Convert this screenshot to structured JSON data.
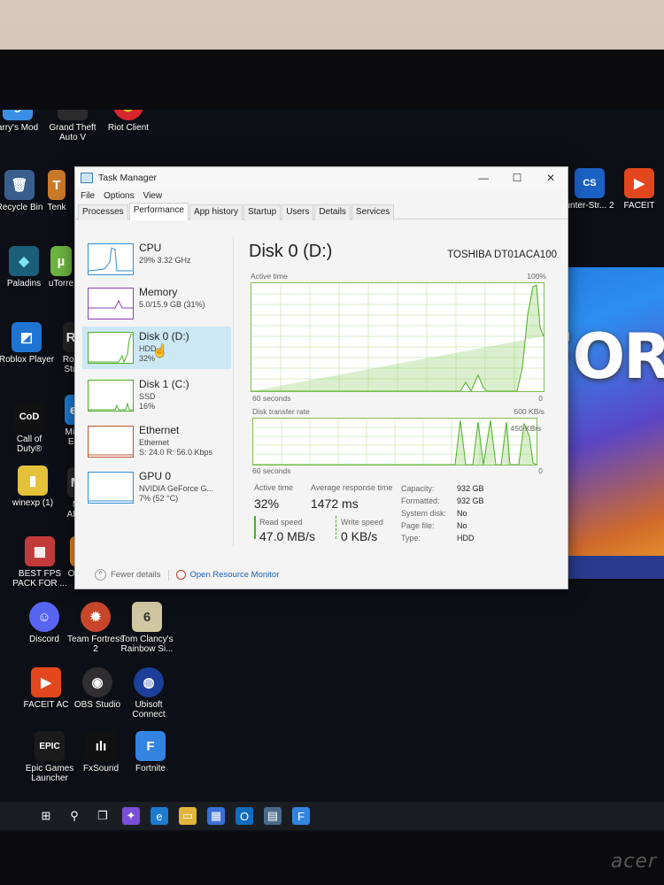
{
  "desktop": {
    "icons": [
      {
        "label": "arry's Mod",
        "glyph": "g",
        "color": "#3a8ee6"
      },
      {
        "label": "Grand Theft Auto V",
        "glyph": "V",
        "color": "#2b2b2b"
      },
      {
        "label": "Riot Client",
        "glyph": "✊",
        "color": "#d7262e"
      },
      {
        "label": "Recycle Bin",
        "glyph": "🗑",
        "color": "#3a5f8f"
      },
      {
        "label": "Tenk",
        "glyph": "T",
        "color": "#cc7a2a"
      },
      {
        "label": "Paladins",
        "glyph": "◆",
        "color": "#3fb0c8"
      },
      {
        "label": "uTorre",
        "glyph": "µ",
        "color": "#6db33f"
      },
      {
        "label": "Roblox Player",
        "glyph": "◩",
        "color": "#1f74d2"
      },
      {
        "label": "Rob Stu",
        "glyph": "R",
        "color": "#222"
      },
      {
        "label": "Call of Duty®",
        "glyph": "CoD",
        "color": "#111"
      },
      {
        "label": "Micr Ed",
        "glyph": "e",
        "color": "#1e7ad1"
      },
      {
        "label": "winexp (1)",
        "glyph": "▮",
        "color": "#e4c13b"
      },
      {
        "label": "M After",
        "glyph": "M",
        "color": "#2a2a2a"
      },
      {
        "label": "BEST FPS PACK FOR ...",
        "glyph": "▦",
        "color": "#c23b3b"
      },
      {
        "label": "Overv",
        "glyph": "◎",
        "color": "#f08a1c"
      },
      {
        "label": "Discord",
        "glyph": "☺",
        "color": "#5865f2"
      },
      {
        "label": "Team Fortress 2",
        "glyph": "✹",
        "color": "#c8472b"
      },
      {
        "label": "Tom Clancy's Rainbow Si...",
        "glyph": "6",
        "color": "#d0c7a2"
      },
      {
        "label": "FACEIT AC",
        "glyph": "▶",
        "color": "#e2471d"
      },
      {
        "label": "OBS Studio",
        "glyph": "◉",
        "color": "#302e31"
      },
      {
        "label": "Ubisoft Connect",
        "glyph": "◍",
        "color": "#1c3f9a"
      },
      {
        "label": "Epic Games Launcher",
        "glyph": "EPIC",
        "color": "#1b1b1b"
      },
      {
        "label": "FxSound",
        "glyph": "ılı",
        "color": "#111"
      },
      {
        "label": "Fortnite",
        "glyph": "F",
        "color": "#3384e0"
      },
      {
        "label": "unter-Str... 2",
        "glyph": "CS",
        "color": "#1b61c4"
      },
      {
        "label": "FACEIT",
        "glyph": "▶",
        "color": "#e2471d"
      }
    ],
    "wallpaper_text": "FOR"
  },
  "taskmanager": {
    "title": "Task Manager",
    "window_controls": [
      "—",
      "☐",
      "✕"
    ],
    "menu": [
      "File",
      "Options",
      "View"
    ],
    "tabs": [
      "Processes",
      "Performance",
      "App history",
      "Startup",
      "Users",
      "Details",
      "Services"
    ],
    "active_tab": "Performance",
    "sidebar": [
      {
        "name": "CPU",
        "line1": "29% 3.32 GHz",
        "line2": "",
        "color": "#2f8fd8"
      },
      {
        "name": "Memory",
        "line1": "5.0/15.9 GB (31%)",
        "line2": "",
        "color": "#8b3fb5"
      },
      {
        "name": "Disk 0 (D:)",
        "line1": "HDD",
        "line2": "32%",
        "color": "#4caf28"
      },
      {
        "name": "Disk 1 (C:)",
        "line1": "SSD",
        "line2": "16%",
        "color": "#4caf28"
      },
      {
        "name": "Ethernet",
        "line1": "Ethernet",
        "line2": "S: 24.0  R: 56.0 Kbps",
        "color": "#c0522b"
      },
      {
        "name": "GPU 0",
        "line1": "NVIDIA GeForce G...",
        "line2": "7% (52 °C)",
        "color": "#2f8fd8"
      }
    ],
    "detail": {
      "title": "Disk 0 (D:)",
      "model": "TOSHIBA DT01ACA100",
      "graph1_label": "Active time",
      "graph1_max": "100%",
      "graph1_xleft": "60 seconds",
      "graph1_xright": "0",
      "graph2_label": "Disk transfer rate",
      "graph2_max": "500 KB/s",
      "graph2_mid": "450 KB/s",
      "graph2_xleft": "60 seconds",
      "graph2_xright": "0",
      "active_time_label": "Active time",
      "active_time_value": "32%",
      "avg_resp_label": "Average response time",
      "avg_resp_value": "1472 ms",
      "read_speed_label": "Read speed",
      "read_speed_value": "47.0 MB/s",
      "write_speed_label": "Write speed",
      "write_speed_value": "0 KB/s",
      "props": [
        {
          "k": "Capacity:",
          "v": "932 GB"
        },
        {
          "k": "Formatted:",
          "v": "932 GB"
        },
        {
          "k": "System disk:",
          "v": "No"
        },
        {
          "k": "Page file:",
          "v": "No"
        },
        {
          "k": "Type:",
          "v": "HDD"
        }
      ]
    },
    "footer": {
      "fewer_details": "Fewer details",
      "open_resource_monitor": "Open Resource Monitor"
    }
  },
  "monitor_brand": "acer"
}
